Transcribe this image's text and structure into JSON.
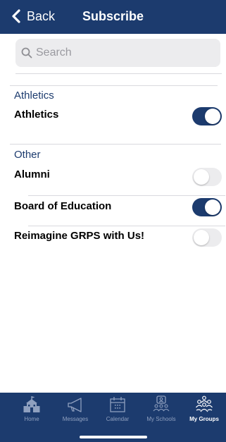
{
  "header": {
    "back_label": "Back",
    "title": "Subscribe"
  },
  "search": {
    "placeholder": "Search"
  },
  "sections": [
    {
      "label": "Athletics",
      "items": [
        {
          "label": "Athletics",
          "subscribed": true
        }
      ]
    },
    {
      "label": "Other",
      "items": [
        {
          "label": "Alumni",
          "subscribed": false
        },
        {
          "label": "Board of Education",
          "subscribed": true
        },
        {
          "label": "Reimagine GRPS with Us!",
          "subscribed": false
        }
      ]
    }
  ],
  "tabbar": {
    "tabs": [
      {
        "label": "Home",
        "icon": "school-house-icon",
        "active": false
      },
      {
        "label": "Messages",
        "icon": "megaphone-icon",
        "active": false
      },
      {
        "label": "Calendar",
        "icon": "calendar-icon",
        "active": false
      },
      {
        "label": "My Schools",
        "icon": "schools-people-icon",
        "active": false
      },
      {
        "label": "My Groups",
        "icon": "groups-icon",
        "active": true
      }
    ]
  },
  "colors": {
    "brand": "#1c3b6e",
    "toggle_off": "#ececee",
    "tab_inactive": "#8fa0bf"
  }
}
